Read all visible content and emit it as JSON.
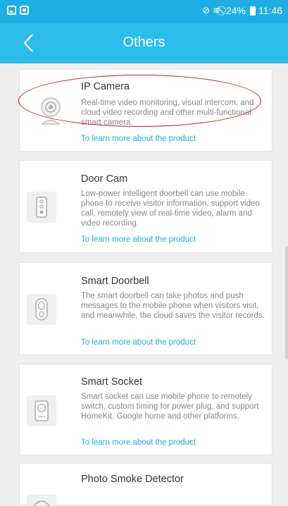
{
  "status_bar": {
    "left_icons": [
      "image-icon",
      "record-icon"
    ],
    "right_icons": [
      "mute-icon",
      "wifi-icon",
      "no-sim-icon"
    ],
    "battery": "24%",
    "time": "11:46"
  },
  "header": {
    "title": "Others",
    "back_icon": "chevron-left-icon"
  },
  "products": [
    {
      "title": "IP Camera",
      "description": "Real-time video monitoring, visual intercom, and cloud video recording and other multi-functional smart camera.",
      "link": "To learn more about the product",
      "icon": "ip-camera-icon"
    },
    {
      "title": "Door Cam",
      "description": "Low-power intelligent doorbell can use mobile phone to receive visitor information, support video call, remotely view of real-time video, alarm and video recording.",
      "link": "To learn more about the product",
      "icon": "door-cam-icon"
    },
    {
      "title": "Smart Doorbell",
      "description": "The smart doorbell can take photos and push messages to the mobile phone when visitors visit, and meanwhile, the cloud saves the visitor records.",
      "link": "To learn more about the product",
      "icon": "smart-doorbell-icon"
    },
    {
      "title": "Smart Socket",
      "description": "Smart socket can use mobile phone to remotely switch, custom timing for power plug, and support HomeKit, Google home and other platforms.",
      "link": "To learn more about the product",
      "icon": "smart-socket-icon"
    },
    {
      "title": "Photo Smoke Detector",
      "icon": "smoke-detector-icon"
    }
  ],
  "colors": {
    "header": "#2bbcea",
    "status_bar": "#1eaee4",
    "link": "#1eaee4",
    "highlight_oval": "#c01a1a"
  }
}
